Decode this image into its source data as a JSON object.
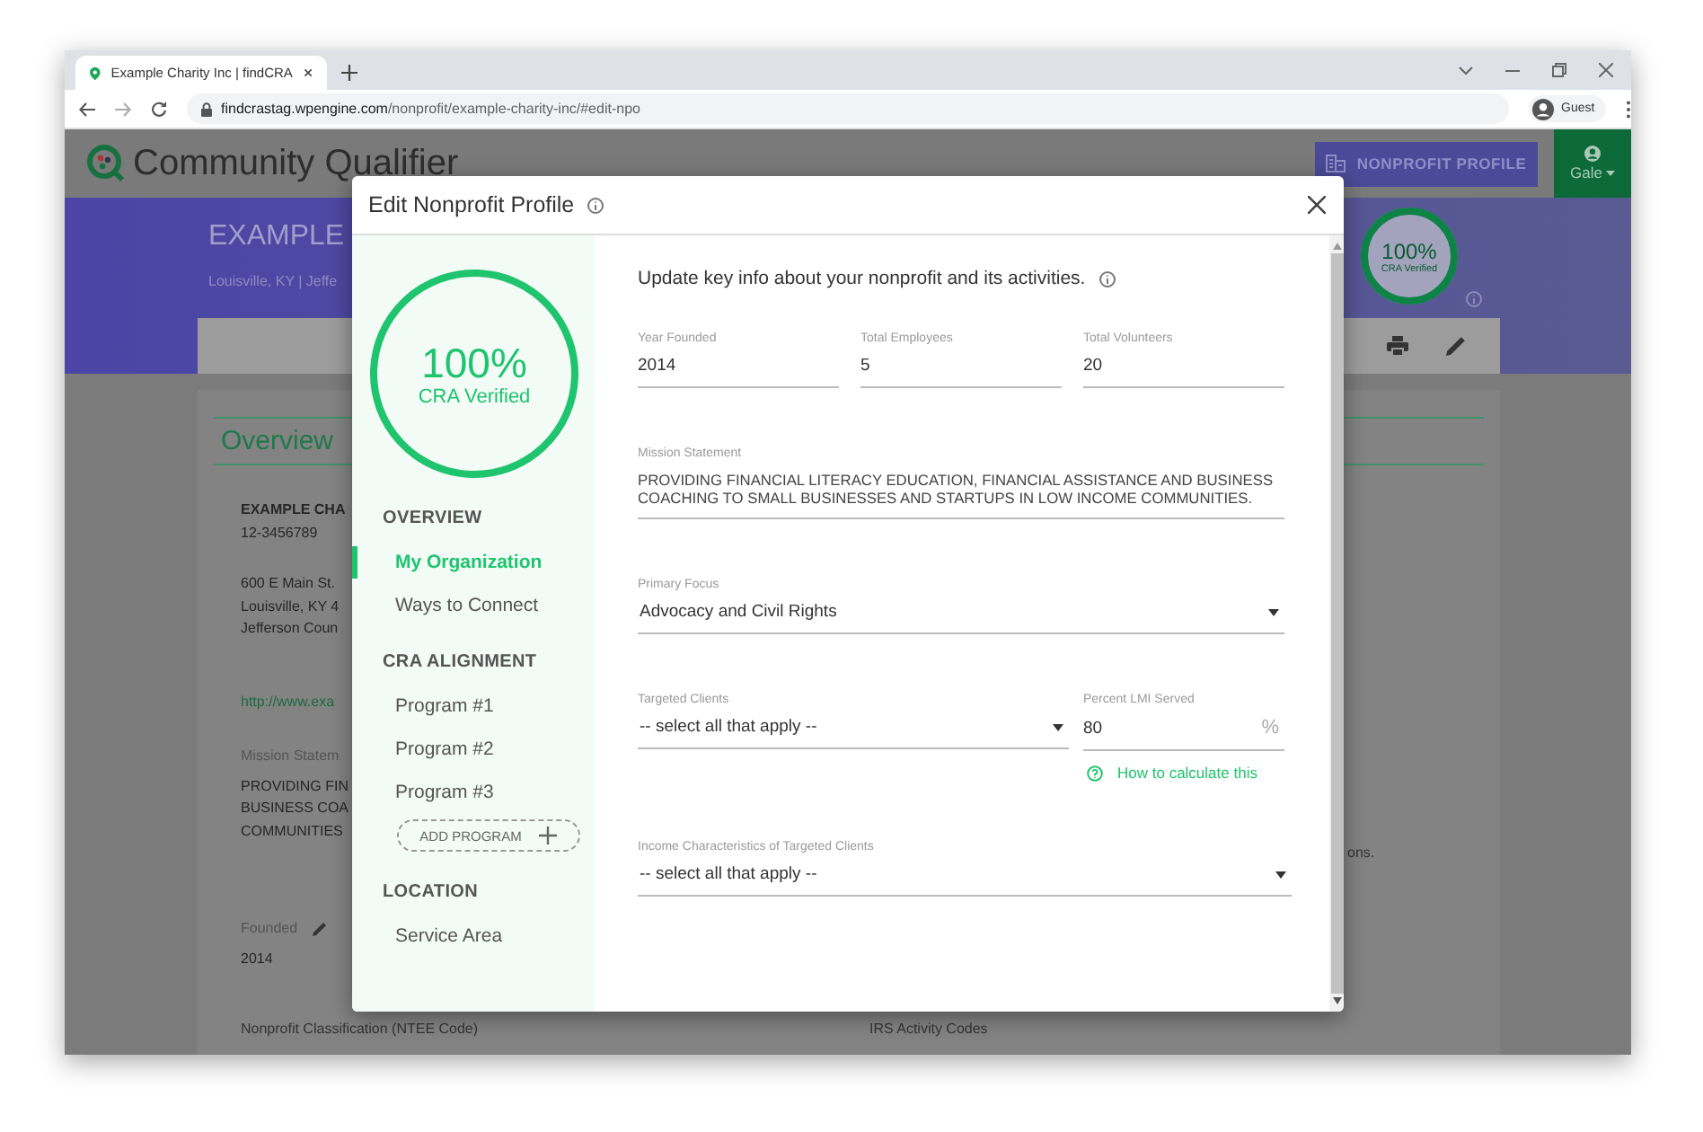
{
  "browser": {
    "tab_title": "Example Charity Inc | findCRA",
    "url_domain": "findcrastag.wpengine.com",
    "url_path": "/nonprofit/example-charity-inc/#edit-npo",
    "profile": "Guest"
  },
  "site": {
    "logo": "Community Qualifier",
    "nav_button": "NONPROFIT PROFILE",
    "user": "Gale",
    "org_name": "EXAMPLE",
    "location": "Louisville, KY | Jeffe",
    "badge": {
      "percent": "100%",
      "caption": "CRA Verified",
      "level": 1
    },
    "overview_title": "Overview",
    "blocks": [
      {
        "kind": "org",
        "lines": [
          "EXAMPLE CHA",
          "12-3456789"
        ]
      },
      {
        "kind": "address",
        "lines": [
          "600 E Main St.",
          "Louisville, KY 4",
          "Jefferson Coun"
        ]
      },
      {
        "kind": "link",
        "lines": [
          "http://www.exa"
        ]
      },
      {
        "kind": "field",
        "lines": [
          "Mission Statem",
          "PROVIDING FIN",
          "BUSINESS COA",
          "COMMUNITIES"
        ]
      },
      {
        "kind": "editable",
        "lines": [
          "Founded",
          "2014"
        ]
      }
    ],
    "side_text": "ons.",
    "footer_labels": [
      "Nonprofit Classification (NTEE Code)",
      "IRS Activity Codes"
    ]
  },
  "modal": {
    "title": "Edit Nonprofit Profile",
    "progress": {
      "percent": "100%",
      "caption": "CRA Verified",
      "level": 1
    },
    "nav": [
      {
        "heading": "OVERVIEW",
        "items": [
          {
            "label": "My Organization",
            "selected": true
          },
          {
            "label": "Ways to Connect",
            "selected": false
          }
        ]
      },
      {
        "heading": "CRA ALIGNMENT",
        "items": [
          {
            "label": "Program #1",
            "selected": false
          },
          {
            "label": "Program #2",
            "selected": false
          },
          {
            "label": "Program #3",
            "selected": false
          }
        ],
        "add_button": "ADD PROGRAM"
      },
      {
        "heading": "LOCATION",
        "items": [
          {
            "label": "Service Area",
            "selected": false
          }
        ]
      }
    ],
    "intro": "Update key info about your nonprofit and its activities.",
    "rows": [
      {
        "fields": [
          {
            "kind": "text",
            "label": "Year Founded",
            "value": "2014"
          },
          {
            "kind": "text",
            "label": "Total Employees",
            "value": "5"
          },
          {
            "kind": "text",
            "label": "Total Volunteers",
            "value": "20"
          }
        ]
      },
      {
        "fields": [
          {
            "kind": "textarea",
            "label": "Mission Statement",
            "value": "PROVIDING FINANCIAL LITERACY EDUCATION, FINANCIAL ASSISTANCE AND BUSINESS COACHING TO SMALL BUSINESSES AND STARTUPS IN LOW INCOME COMMUNITIES."
          }
        ]
      },
      {
        "fields": [
          {
            "kind": "select",
            "label": "Primary Focus",
            "value": "Advocacy and Civil Rights"
          }
        ]
      },
      {
        "fields": [
          {
            "kind": "select",
            "label": "Targeted Clients",
            "placeholder": "-- select all that apply --"
          },
          {
            "kind": "number",
            "label": "Percent LMI Served",
            "value": "80",
            "unit": "%",
            "help": "How to calculate this"
          }
        ]
      },
      {
        "fields": [
          {
            "kind": "select",
            "label": "Income Characteristics of Targeted Clients",
            "placeholder": "-- select all that apply --"
          }
        ]
      }
    ]
  }
}
